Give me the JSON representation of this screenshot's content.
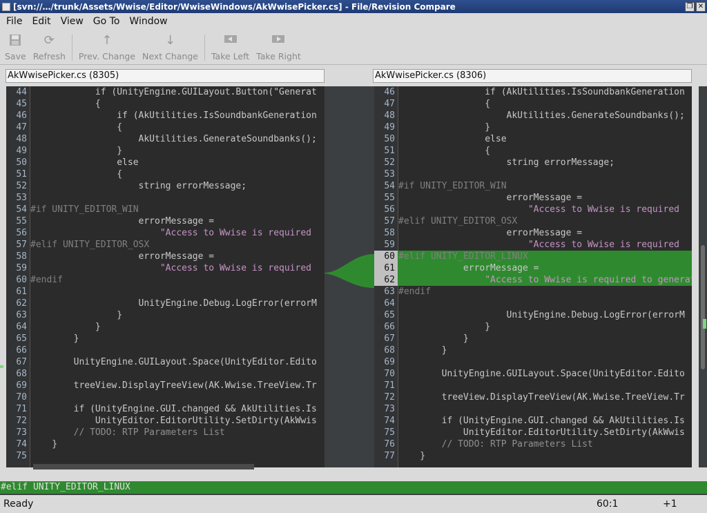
{
  "window": {
    "title": "[svn://…/trunk/Assets/Wwise/Editor/WwiseWindows/AkWwisePicker.cs] - File/Revision Compare"
  },
  "menu": [
    "File",
    "Edit",
    "View",
    "Go To",
    "Window"
  ],
  "toolbar": {
    "save": "Save",
    "refresh": "Refresh",
    "prev_change": "Prev. Change",
    "next_change": "Next Change",
    "take_left": "Take Left",
    "take_right": "Take Right"
  },
  "left": {
    "filename": "AkWwisePicker.cs (8305)",
    "lines": [
      {
        "n": "44",
        "t": "            if (UnityEngine.GUILayout.Button(\"Generat"
      },
      {
        "n": "45",
        "t": "            {"
      },
      {
        "n": "46",
        "t": "                if (AkUtilities.IsSoundbankGeneration"
      },
      {
        "n": "47",
        "t": "                {"
      },
      {
        "n": "48",
        "t": "                    AkUtilities.GenerateSoundbanks();"
      },
      {
        "n": "49",
        "t": "                }"
      },
      {
        "n": "50",
        "t": "                else"
      },
      {
        "n": "51",
        "t": "                {"
      },
      {
        "n": "52",
        "t": "                    string errorMessage;"
      },
      {
        "n": "53",
        "t": ""
      },
      {
        "n": "54",
        "t": "#if UNITY_EDITOR_WIN"
      },
      {
        "n": "55",
        "t": "                    errorMessage ="
      },
      {
        "n": "56",
        "t": "                        \"Access to Wwise is required"
      },
      {
        "n": "57",
        "t": "#elif UNITY_EDITOR_OSX"
      },
      {
        "n": "58",
        "t": "                    errorMessage ="
      },
      {
        "n": "59",
        "t": "                        \"Access to Wwise is required"
      },
      {
        "n": "60",
        "t": "#endif"
      },
      {
        "n": "61",
        "t": ""
      },
      {
        "n": "62",
        "t": "                    UnityEngine.Debug.LogError(errorM"
      },
      {
        "n": "63",
        "t": "                }"
      },
      {
        "n": "64",
        "t": "            }"
      },
      {
        "n": "65",
        "t": "        }"
      },
      {
        "n": "66",
        "t": ""
      },
      {
        "n": "67",
        "t": "        UnityEngine.GUILayout.Space(UnityEditor.Edito"
      },
      {
        "n": "68",
        "t": ""
      },
      {
        "n": "69",
        "t": "        treeView.DisplayTreeView(AK.Wwise.TreeView.Tr"
      },
      {
        "n": "70",
        "t": ""
      },
      {
        "n": "71",
        "t": "        if (UnityEngine.GUI.changed && AkUtilities.Is"
      },
      {
        "n": "72",
        "t": "            UnityEditor.EditorUtility.SetDirty(AkWwis"
      },
      {
        "n": "73",
        "t": "        // TODO: RTP Parameters List"
      },
      {
        "n": "74",
        "t": "    }"
      },
      {
        "n": "75",
        "t": ""
      }
    ]
  },
  "right": {
    "filename": "AkWwisePicker.cs (8306)",
    "highlight_line": "60",
    "lines": [
      {
        "n": "46",
        "t": "                if (AkUtilities.IsSoundbankGeneration"
      },
      {
        "n": "47",
        "t": "                {"
      },
      {
        "n": "48",
        "t": "                    AkUtilities.GenerateSoundbanks();"
      },
      {
        "n": "49",
        "t": "                }"
      },
      {
        "n": "50",
        "t": "                else"
      },
      {
        "n": "51",
        "t": "                {"
      },
      {
        "n": "52",
        "t": "                    string errorMessage;"
      },
      {
        "n": "53",
        "t": ""
      },
      {
        "n": "54",
        "t": "#if UNITY_EDITOR_WIN"
      },
      {
        "n": "55",
        "t": "                    errorMessage ="
      },
      {
        "n": "56",
        "t": "                        \"Access to Wwise is required"
      },
      {
        "n": "57",
        "t": "#elif UNITY_EDITOR_OSX"
      },
      {
        "n": "58",
        "t": "                    errorMessage ="
      },
      {
        "n": "59",
        "t": "                        \"Access to Wwise is required"
      },
      {
        "n": "60",
        "t": "#elif UNITY_EDITOR_LINUX"
      },
      {
        "n": "61",
        "t": "            errorMessage ="
      },
      {
        "n": "62",
        "t": "                \"Access to Wwise is required to generate"
      },
      {
        "n": "63",
        "t": "#endif"
      },
      {
        "n": "64",
        "t": ""
      },
      {
        "n": "65",
        "t": "                    UnityEngine.Debug.LogError(errorM"
      },
      {
        "n": "66",
        "t": "                }"
      },
      {
        "n": "67",
        "t": "            }"
      },
      {
        "n": "68",
        "t": "        }"
      },
      {
        "n": "69",
        "t": ""
      },
      {
        "n": "70",
        "t": "        UnityEngine.GUILayout.Space(UnityEditor.Edito"
      },
      {
        "n": "71",
        "t": ""
      },
      {
        "n": "72",
        "t": "        treeView.DisplayTreeView(AK.Wwise.TreeView.Tr"
      },
      {
        "n": "73",
        "t": ""
      },
      {
        "n": "74",
        "t": "        if (UnityEngine.GUI.changed && AkUtilities.Is"
      },
      {
        "n": "75",
        "t": "            UnityEditor.EditorUtility.SetDirty(AkWwis"
      },
      {
        "n": "76",
        "t": "        // TODO: RTP Parameters List"
      },
      {
        "n": "77",
        "t": "    }"
      }
    ]
  },
  "current_line_text": "#elif UNITY_EDITOR_LINUX",
  "status": {
    "state": "Ready",
    "position": "60:1",
    "delta": "+1"
  },
  "colors": {
    "added": "#2f8a2f",
    "editor_bg": "#2b2b2b"
  }
}
